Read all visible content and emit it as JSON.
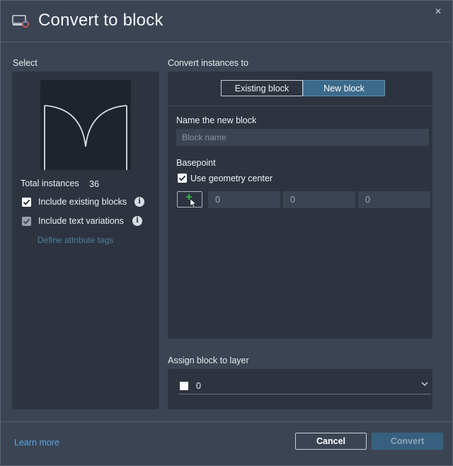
{
  "dialog": {
    "title": "Convert to block",
    "close_glyph": "×",
    "app_icon": "convert-to-block-icon"
  },
  "select": {
    "section_label": "Select",
    "total_instances_label": "Total instances",
    "total_instances_value": "36",
    "include_existing_blocks": {
      "label": "Include existing blocks",
      "checked": true
    },
    "include_text_variations": {
      "label": "Include text variations",
      "checked": true,
      "disabled": true
    },
    "define_attribute_tags": "Define attribute tags"
  },
  "convert": {
    "section_label": "Convert instances to",
    "tabs": [
      {
        "label": "Existing block",
        "active": false
      },
      {
        "label": "New block",
        "active": true
      }
    ],
    "name_label": "Name the new block",
    "name_placeholder": "Block name",
    "basepoint_label": "Basepoint",
    "use_geometry_center": {
      "label": "Use geometry center",
      "checked": true
    },
    "coordinates": [
      "0",
      "0",
      "0"
    ]
  },
  "layer": {
    "section_label": "Assign block to layer",
    "value": "0",
    "swatch_color": "#ffffff"
  },
  "footer": {
    "learn_more": "Learn more",
    "cancel": "Cancel",
    "convert": "Convert"
  },
  "colors": {
    "background": "#3b4453",
    "panel": "#2d3440",
    "accent": "#3c6a8a",
    "link": "#5aa7e0"
  }
}
